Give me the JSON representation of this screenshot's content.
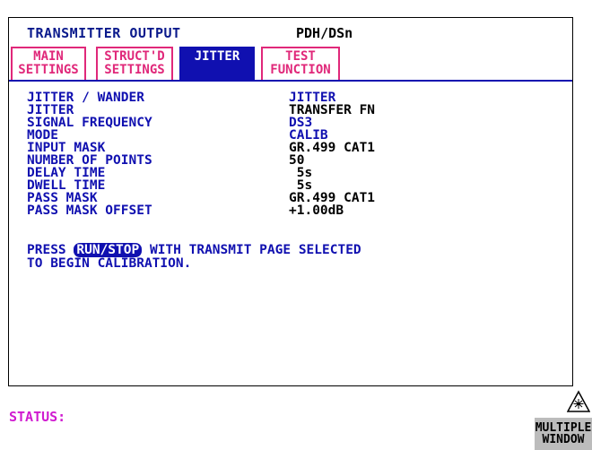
{
  "header": {
    "title": "TRANSMITTER OUTPUT",
    "mode": "PDH/DSn"
  },
  "tabs": [
    {
      "line1": "MAIN",
      "line2": "SETTINGS"
    },
    {
      "line1": "STRUCT'D",
      "line2": "SETTINGS"
    },
    {
      "line1": "JITTER",
      "line2": ""
    },
    {
      "line1": "TEST",
      "line2": "FUNCTION"
    }
  ],
  "settings": [
    {
      "label": "JITTER / WANDER",
      "value": "JITTER"
    },
    {
      "label": "JITTER",
      "value": "TRANSFER FN"
    },
    {
      "label": "SIGNAL FREQUENCY",
      "value": "DS3"
    },
    {
      "label": "MODE",
      "value": "CALIB"
    },
    {
      "label": "INPUT MASK",
      "value": "GR.499 CAT1"
    },
    {
      "label": "NUMBER OF POINTS",
      "value": "50"
    },
    {
      "label": "DELAY TIME",
      "value": " 5s"
    },
    {
      "label": "DWELL TIME",
      "value": " 5s"
    },
    {
      "label": "PASS MASK",
      "value": "GR.499 CAT1"
    },
    {
      "label": "PASS MASK OFFSET",
      "value": "+1.00dB"
    }
  ],
  "message": {
    "prefix": "PRESS ",
    "key": "RUN/STOP",
    "suffix": " WITH TRANSMIT PAGE SELECTED",
    "line2": "TO BEGIN CALIBRATION."
  },
  "status": {
    "label": "STATUS:"
  },
  "softkey": {
    "line1": "MULTIPLE",
    "line2": "WINDOW"
  }
}
